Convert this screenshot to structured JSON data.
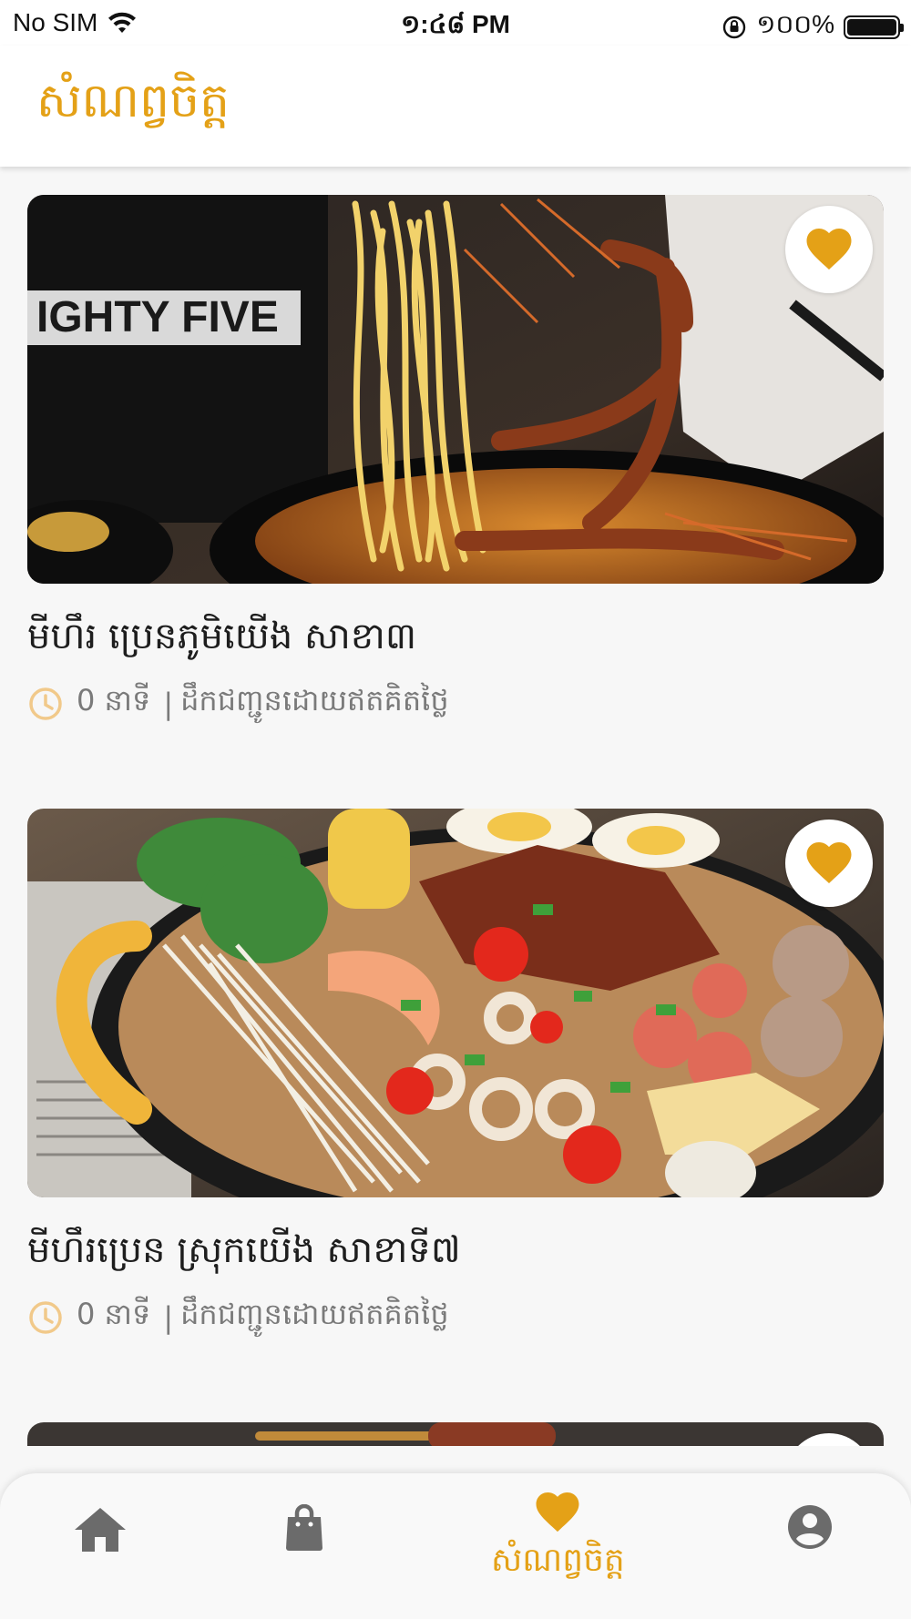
{
  "status_bar": {
    "carrier": "No SIM",
    "time": "១:៤៨ PM",
    "battery": "១០០%",
    "battery_level": 1.0
  },
  "header": {
    "title": "សំណព្វចិត្ត"
  },
  "colors": {
    "accent": "#e4a117",
    "icon_gray": "#6b6b6b",
    "text_dark": "#1e1e1e",
    "text_meta": "#7a7a7a",
    "background": "#f7f7f7"
  },
  "favorites": [
    {
      "name": "មីហឹរ ប្រេនភូមិយើង សាខា៣",
      "duration": "0 នាទី",
      "separator": "|",
      "delivery": "ដឹកជញ្ជូនដោយឥតគិតថ្លៃ",
      "image": "noodle-hotpot-crab-photo",
      "favorited": true
    },
    {
      "name": "មីហឹរប្រេន ស្រុកយើង សាខាទី៧",
      "duration": "0 នាទី",
      "separator": "|",
      "delivery": "ដឹកជញ្ជូនដោយឥតគិតថ្លៃ",
      "image": "seafood-hotpot-photo",
      "favorited": true
    }
  ],
  "bottom_nav": {
    "items": [
      {
        "icon": "home-icon",
        "label": "",
        "active": false
      },
      {
        "icon": "shopping-bag-icon",
        "label": "",
        "active": false
      },
      {
        "icon": "heart-icon",
        "label": "សំណព្វចិត្ត",
        "active": true
      },
      {
        "icon": "account-circle-icon",
        "label": "",
        "active": false
      }
    ]
  }
}
